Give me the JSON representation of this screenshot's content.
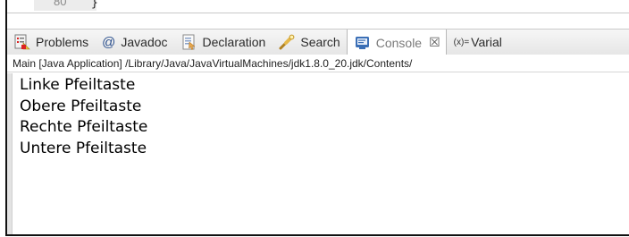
{
  "editor": {
    "line_number": "80",
    "code_fragment": "}"
  },
  "tabs": [
    {
      "label": "Problems",
      "icon": "problems-icon"
    },
    {
      "label": "Javadoc",
      "icon": "javadoc-at-icon",
      "glyph": "@"
    },
    {
      "label": "Declaration",
      "icon": "declaration-icon"
    },
    {
      "label": "Search",
      "icon": "search-flashlight-icon"
    },
    {
      "label": "Console",
      "icon": "console-icon",
      "active": true,
      "close": "☒"
    },
    {
      "label": "Varial",
      "icon": "variables-icon",
      "prefix": "(x)="
    }
  ],
  "console": {
    "title": "Main [Java Application] /Library/Java/JavaVirtualMachines/jdk1.8.0_20.jdk/Contents/",
    "lines": [
      "Linke Pfeiltaste",
      "Obere Pfeiltaste",
      "Rechte Pfeiltaste",
      "Untere Pfeiltaste"
    ]
  },
  "colors": {
    "tabbar_bg": "#ececec",
    "active_tab_bg": "#ffffff",
    "console_icon": "#3b6fb6"
  }
}
